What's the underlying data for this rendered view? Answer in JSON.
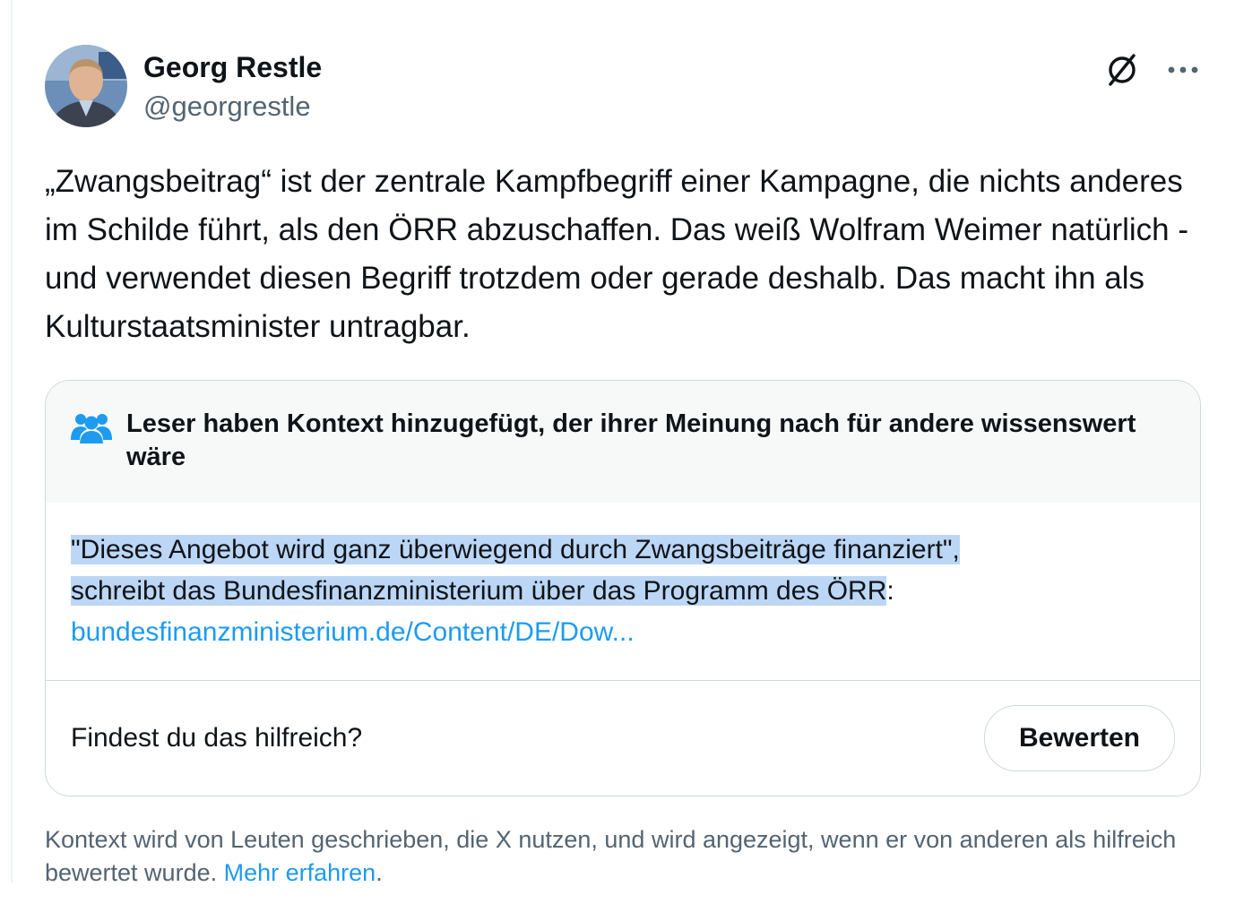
{
  "author": {
    "name": "Georg Restle",
    "handle": "@georgrestle"
  },
  "header_icons": [
    "grok-icon",
    "more-icon"
  ],
  "tweet": {
    "text": "„Zwangsbeitrag“ ist der zentrale Kampfbegriff einer Kampagne, die nichts anderes im Schilde führt, als den ÖRR abzuschaffen. Das weiß Wolfram Weimer natürlich - und verwendet diesen Begriff trotzdem oder gerade deshalb. Das macht ihn als Kulturstaatsminister untragbar."
  },
  "community_note": {
    "icon": "people-icon",
    "title": "Leser haben Kontext hinzugefügt, der ihrer Meinung nach für andere wissenswert wäre",
    "body_quote": "\"Dieses Angebot wird ganz überwiegend durch Zwangsbeiträge finanziert\",",
    "body_rest": "schreibt das Bundesfinanzministerium über das Programm des ÖRR",
    "body_colon": ":",
    "link_text": "bundesfinanzministerium.de/Content/DE/Dow...",
    "question": "Findest du das hilfreich?",
    "rate_label": "Bewerten"
  },
  "disclaimer": {
    "text": "Kontext wird von Leuten geschrieben, die X nutzen, und wird angezeigt, wenn er von anderen als hilfreich bewertet wurde. ",
    "link": "Mehr erfahren",
    "period": "."
  },
  "colors": {
    "accent": "#1d9bf0",
    "text": "#0f1419",
    "secondary": "#536471",
    "border": "#cfd9de",
    "note_header_bg": "#f7f9f9",
    "highlight": "#bcd6f5"
  }
}
